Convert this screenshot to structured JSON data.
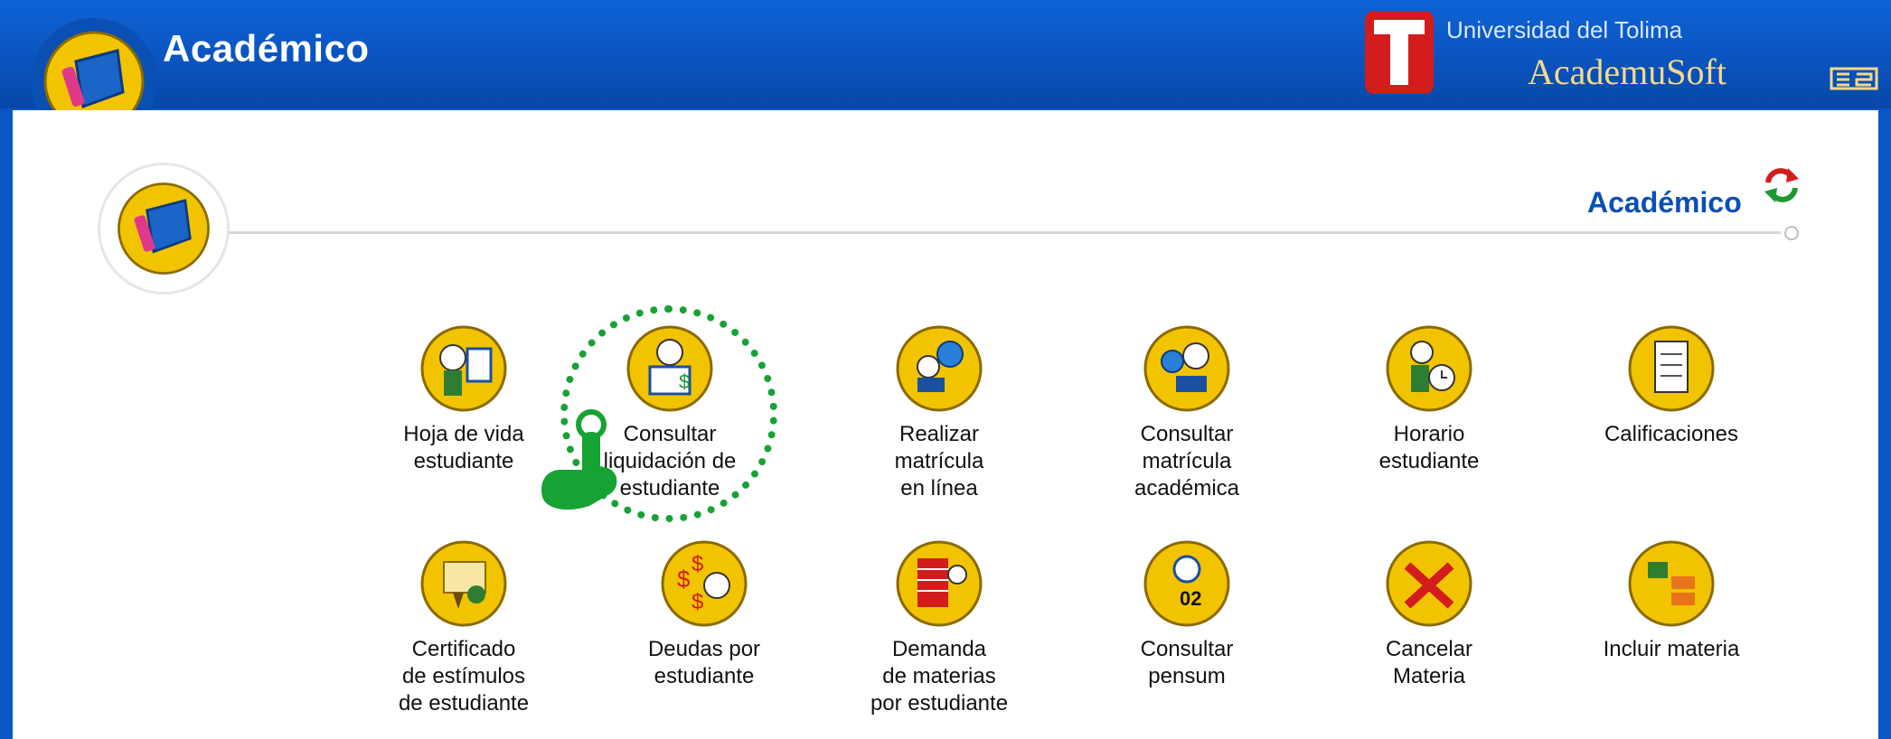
{
  "header": {
    "title": "Académico",
    "university": "Universidad del Tolima",
    "brand": "AcademuSoft"
  },
  "section": {
    "title": "Académico"
  },
  "colors": {
    "frame": "#0a56c4",
    "accent": "#0a4fb4",
    "highlight": "#17a234",
    "icon_gold": "#f2c400"
  },
  "menu": {
    "row1": [
      {
        "label": "Hoja de vida\nestudiante",
        "icon": "cv-icon"
      },
      {
        "label": "Consultar\nliquidación de\nestudiante",
        "icon": "billing-icon"
      },
      {
        "label": "Realizar\nmatrícula\nen línea",
        "icon": "online-enroll-icon"
      },
      {
        "label": "Consultar\nmatrícula\nacadémica",
        "icon": "enroll-view-icon"
      },
      {
        "label": "Horario\nestudiante",
        "icon": "schedule-icon"
      },
      {
        "label": "Calificaciones",
        "icon": "grades-icon"
      }
    ],
    "row2": [
      {
        "label": "Certificado\nde estímulos\nde estudiante",
        "icon": "certificate-icon"
      },
      {
        "label": "Deudas por\nestudiante",
        "icon": "debts-icon"
      },
      {
        "label": "Demanda\nde materias\npor estudiante",
        "icon": "demand-icon"
      },
      {
        "label": "Consultar\npensum",
        "icon": "pensum-icon"
      },
      {
        "label": "Cancelar\nMateria",
        "icon": "cancel-subject-icon"
      },
      {
        "label": "Incluir materia",
        "icon": "add-subject-icon"
      }
    ]
  }
}
